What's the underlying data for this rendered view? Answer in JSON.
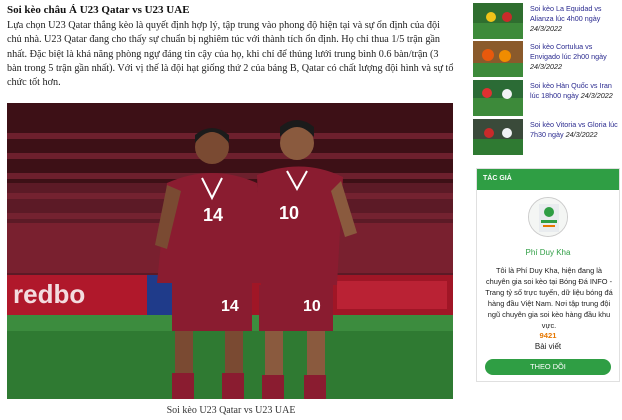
{
  "article": {
    "heading": "Soi kèo châu Á U23 Qatar vs U23 UAE",
    "paragraph": "Lựa chọn U23 Qatar thắng kèo là quyết định hợp lý, tập trung vào phong độ hiện tại và sự ổn định của đội chủ nhà. U23 Qatar đang cho thấy sự chuẩn bị nghiêm túc với thành tích ổn định. Họ chỉ thua 1/5 trận gần nhất. Đặc biệt là khả năng phòng ngự đáng tin cậy của họ, khi chỉ để thủng lưới trung bình 0.6 bàn/trận (3 bàn trong 5 trận gần nhất). Với vị thế là đội hạt giống thứ 2 của bảng B, Qatar có chất lượng đội hình và sự tổ chức tốt hơn.",
    "caption": "Soi kèo U23 Qatar vs U23 UAE",
    "photo": {
      "banner_left": "redbo",
      "player_left_number": "14",
      "player_right_number": "10"
    }
  },
  "sidebar": {
    "news": [
      {
        "title": "Soi kèo La Equidad vs Alianza lúc 4h00 ngày",
        "date": "24/3/2022"
      },
      {
        "title": "Soi kèo Cortulua vs Envigado lúc 2h00 ngày",
        "date": "24/3/2022"
      },
      {
        "title": "Soi kèo Hàn Quốc vs Iran lúc 18h00 ngày",
        "date": "24/3/2022"
      },
      {
        "title": "Soi kèo Vitoria vs Gloria lúc 7h30 ngày",
        "date": "24/3/2022"
      }
    ],
    "author": {
      "header": "TÁC GIẢ",
      "name": "Phí Duy Kha",
      "description": "Tôi là Phí Duy Kha, hiện đang là chuyên gia soi kèo tại Bóng Đá INFO - Trang tỷ số trực tuyến, dữ liệu bóng đá hàng đầu Việt Nam. Nơi tập trung đội ngũ chuyên gia soi kèo hàng đầu khu vực.",
      "post_count": "9421",
      "post_label": "Bài viết",
      "follow_label": "THEO DÕI"
    }
  },
  "colors": {
    "accent_green": "#2f9e44",
    "link_blue": "#2a2a8f",
    "count_orange": "#e67700",
    "jersey_maroon": "#8a1c30"
  }
}
